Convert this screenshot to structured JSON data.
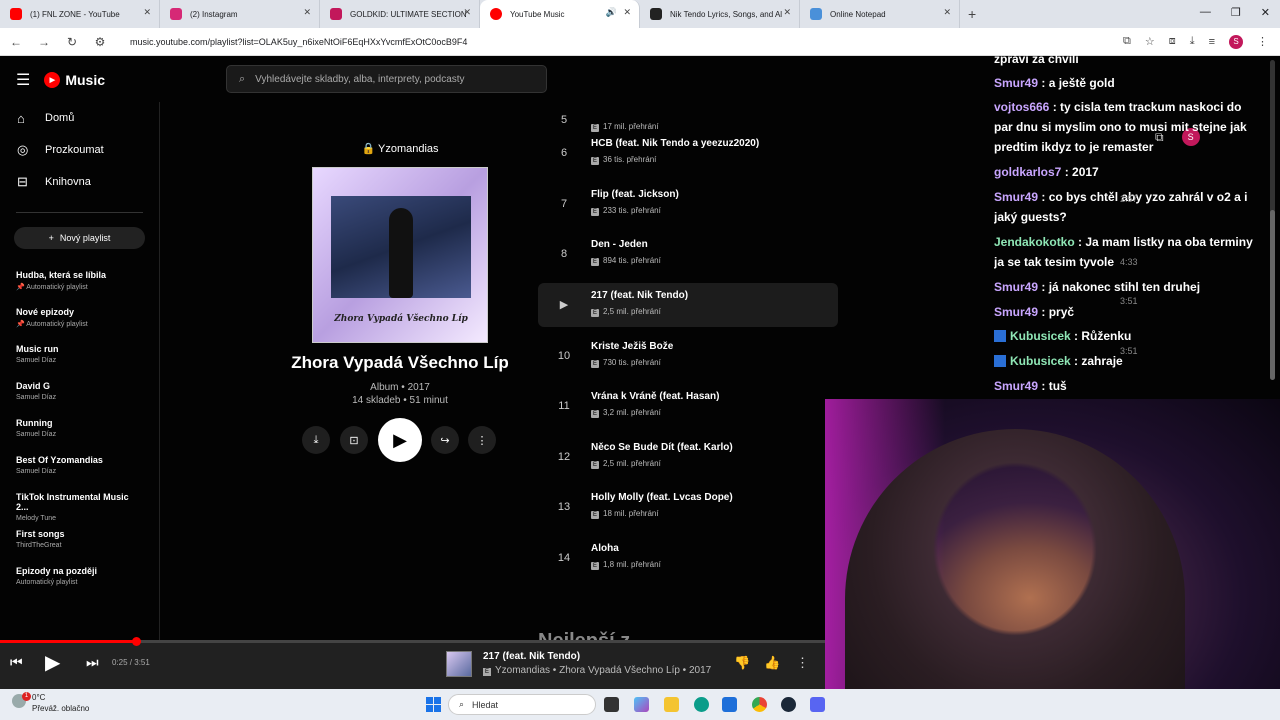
{
  "browser": {
    "tabs": [
      {
        "title": "(1) FNL ZONE - YouTube",
        "color": "#ff0000"
      },
      {
        "title": "(2) Instagram",
        "color": "#d62976"
      },
      {
        "title": "GOLDKID: ULTIMATE SECTION",
        "color": "#c2185b"
      },
      {
        "title": "YouTube Music",
        "color": "#ff0000"
      },
      {
        "title": "Nik Tendo Lyrics, Songs, and Al",
        "color": "#222222"
      },
      {
        "title": "Online Notepad",
        "color": "#4a90d9"
      }
    ],
    "url": "music.youtube.com/playlist?list=OLAK5uy_n6ixeNtOiF6EqHXxYvcmfExOtC0ocB9F4",
    "profile_initial": "S"
  },
  "ytmusic": {
    "logo_text": "Music",
    "search_placeholder": "Vyhledávejte skladby, alba, interprety, podcasty",
    "nav": [
      {
        "label": "Domů",
        "icon": "home-icon"
      },
      {
        "label": "Prozkoumat",
        "icon": "explore-icon"
      },
      {
        "label": "Knihovna",
        "icon": "library-icon"
      }
    ],
    "new_playlist": "Nový playlist",
    "playlists": [
      {
        "title": "Hudba, která se líbila",
        "sub": "📌 Automatický playlist"
      },
      {
        "title": "Nové epizody",
        "sub": "📌 Automatický playlist"
      },
      {
        "title": "Music run",
        "sub": "Samuel Díaz"
      },
      {
        "title": "David G",
        "sub": "Samuel Díaz"
      },
      {
        "title": "Running",
        "sub": "Samuel Díaz"
      },
      {
        "title": "Best Of Yzomandias",
        "sub": "Samuel Díaz"
      },
      {
        "title": "TikTok Instrumental Music 2...",
        "sub": "Melody Tune"
      },
      {
        "title": "First songs",
        "sub": "ThirdTheGreat"
      },
      {
        "title": "Epizody na později",
        "sub": "Automatický playlist"
      }
    ],
    "album": {
      "artist": "Yzomandias",
      "cover_text": "Zhora Vypadá Všechno Líp",
      "title": "Zhora Vypadá Všechno Líp",
      "meta_line1": "Album • 2017",
      "meta_line2": "14 skladeb • 51 minut"
    },
    "tracks": [
      {
        "num": "5",
        "title": "",
        "views": "17 mil. přehrání"
      },
      {
        "num": "6",
        "title": "HCB (feat. Nik Tendo a yeezuz2020)",
        "views": "36 tis. přehrání"
      },
      {
        "num": "7",
        "title": "Flip (feat. Jickson)",
        "views": "233 tis. přehrání"
      },
      {
        "num": "8",
        "title": "Den - Jeden",
        "views": "894 tis. přehrání"
      },
      {
        "num": "▶",
        "title": "217 (feat. Nik Tendo)",
        "views": "2,5 mil. přehrání"
      },
      {
        "num": "10",
        "title": "Kriste Ježiš Bože",
        "views": "730 tis. přehrání"
      },
      {
        "num": "11",
        "title": "Vrána k Vráně (feat. Hasan)",
        "views": "3,2 mil. přehrání"
      },
      {
        "num": "12",
        "title": "Něco Se Bude Dít (feat. Karlo)",
        "views": "2,5 mil. přehrání"
      },
      {
        "num": "13",
        "title": "Holly Molly (feat. Lvcas Dope)",
        "views": "18 mil. přehrání"
      },
      {
        "num": "14",
        "title": "Aloha",
        "views": "1,8 mil. přehrání"
      }
    ],
    "more_heading": "Nejlepší z...",
    "player": {
      "time": "0:25 / 3:51",
      "progress": 0.108,
      "now_title": "217 (feat. Nik Tendo)",
      "now_sub": "Yzomandias • Zhora Vypadá Všechno Líp • 2017"
    }
  },
  "chat": [
    {
      "user": "",
      "text": "zprávi za chvíli",
      "color": "#ffffff"
    },
    {
      "user": "Smur49",
      "text": " : a ještě gold",
      "color": "#c9a6ff"
    },
    {
      "user": "vojtos666",
      "text": " : ty cisla tem trackum naskoci do par dnu si myslim ono to musi mit stejne jak predtim ikdyz to je remaster",
      "color": "#c9a6ff"
    },
    {
      "user": "goldkarlos7",
      "text": " : 2017",
      "color": "#c9a6ff"
    },
    {
      "user": "Smur49",
      "text": " : co bys chtěl aby yzo zahrál v o2 a i jaký guests?",
      "color": "#c9a6ff"
    },
    {
      "user": "Jendakokotko",
      "text": " : Ja mam listky na oba terminy ja se tak tesim tyvole",
      "color": "#8fe6b5"
    },
    {
      "user": "Smur49",
      "text": " : já nakonec stihl ten druhej",
      "color": "#c9a6ff"
    },
    {
      "user": "Smur49",
      "text": " : pryč",
      "color": "#c9a6ff"
    },
    {
      "user": "Kubusicek",
      "text": " : Růženku",
      "color": "#8fe6b5"
    },
    {
      "user": "Kubusicek",
      "text": " : zahraje",
      "color": "#8fe6b5"
    },
    {
      "user": "Smur49",
      "text": " : tuš",
      "color": "#c9a6ff"
    }
  ],
  "chat_timestamps": [
    "2:57",
    "4:33",
    "3:51",
    "3:51"
  ],
  "taskbar": {
    "temp": "0°C",
    "weather": "Převáž. oblačno",
    "badge": "1",
    "search": "Hledat"
  }
}
